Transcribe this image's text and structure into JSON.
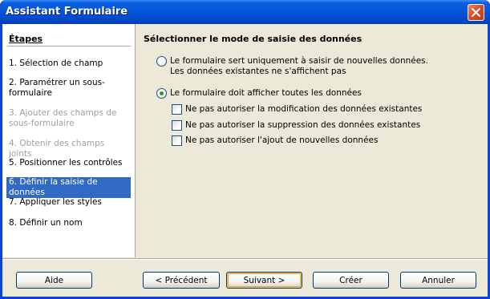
{
  "window": {
    "title": "Assistant Formulaire"
  },
  "sidebar": {
    "heading": "Étapes",
    "steps": [
      {
        "label": "1. Sélection de champ",
        "state": "normal"
      },
      {
        "label": "2. Paramétrer un sous-formulaire",
        "state": "normal"
      },
      {
        "label": "3. Ajouter des champs de sous-formulaire",
        "state": "disabled"
      },
      {
        "label": "4. Obtenir des champs joints",
        "state": "disabled"
      },
      {
        "label": "5. Positionner les contrôles",
        "state": "normal"
      },
      {
        "label": "6. Définir la saisie de données",
        "state": "active"
      },
      {
        "label": "7. Appliquer les styles",
        "state": "normal"
      },
      {
        "label": "8. Définir un nom",
        "state": "normal"
      }
    ]
  },
  "main": {
    "title": "Sélectionner le mode de saisie des données",
    "radio_new_only": {
      "line1": "Le formulaire sert uniquement à saisir de nouvelles données.",
      "line2": "Les données existantes ne s'affichent pas",
      "checked": false
    },
    "radio_show_all": {
      "label": "Le formulaire doit afficher toutes les données",
      "checked": true
    },
    "options": [
      {
        "label": "Ne pas autoriser la modification des données existantes",
        "checked": false
      },
      {
        "label": "Ne pas autoriser la suppression des données existantes",
        "checked": false
      },
      {
        "label": "Ne pas autoriser l'ajout de nouvelles données",
        "checked": false
      }
    ]
  },
  "buttons": {
    "help": "Aide",
    "previous": "< Précédent",
    "next": "Suivant >",
    "create": "Créer",
    "cancel": "Annuler"
  },
  "colors": {
    "titlebar": "#0454d8",
    "selection": "#316ac5",
    "dialog_bg": "#ece9d8"
  }
}
